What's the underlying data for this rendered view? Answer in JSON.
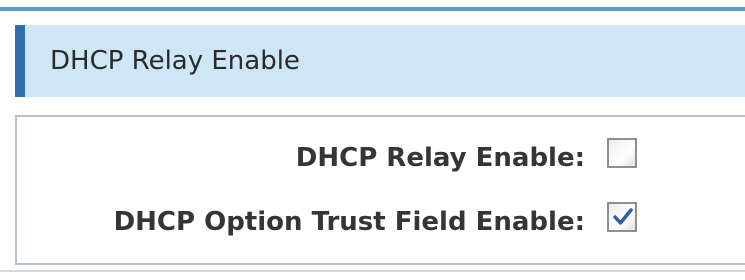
{
  "section": {
    "title": "DHCP Relay Enable"
  },
  "fields": [
    {
      "label": "DHCP Relay Enable:",
      "checked": false
    },
    {
      "label": "DHCP Option Trust Field Enable:",
      "checked": true
    }
  ],
  "colors": {
    "header_background": "#cfe6f6",
    "header_accent": "#2f6fae",
    "checkmark": "#2d5fa8"
  }
}
